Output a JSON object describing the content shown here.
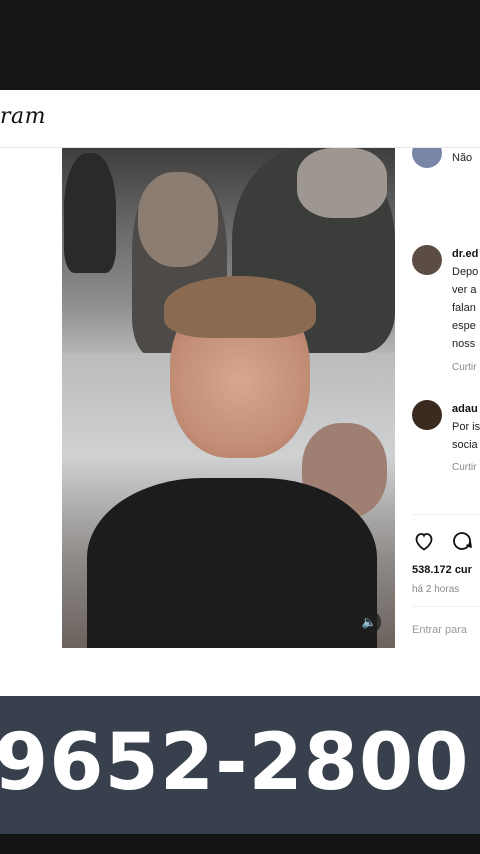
{
  "header": {
    "logo_text": "ram"
  },
  "post": {
    "media_alt": "video frame",
    "volume_icon": "speaker-icon",
    "comments": [
      {
        "username": "",
        "lines": [
          "Não"
        ],
        "meta": ""
      },
      {
        "username": "dr.ed",
        "lines": [
          "Depo",
          "ver a",
          "falan",
          "espe",
          "noss"
        ],
        "meta": "Curtir"
      },
      {
        "username": "adau",
        "lines": [
          "Por is",
          "socia"
        ],
        "meta": "Curtir"
      }
    ],
    "likes": "538.172 cur",
    "time": "há 2 horas",
    "comment_placeholder": "Entrar para"
  },
  "banner": {
    "phone": "9652-2800"
  },
  "colors": {
    "banner_bg": "#39404d",
    "top_bar": "#161616"
  }
}
